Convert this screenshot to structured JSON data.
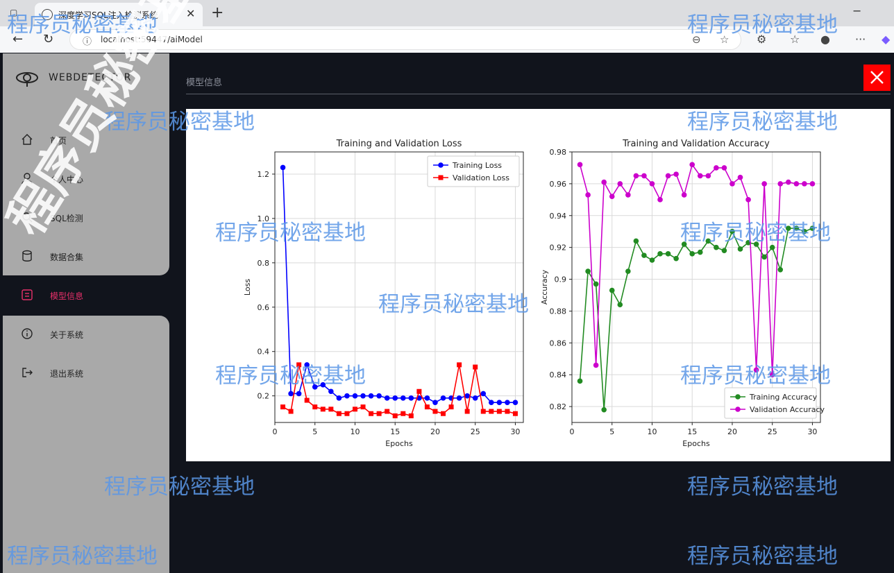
{
  "browser": {
    "tab_title": "深度学习SQL注入检测系统",
    "url": "localhost:59447/aiModel"
  },
  "sidebar": {
    "logo_text": "WEBDETECTOR",
    "items": [
      {
        "label": "首页",
        "icon": "home-icon"
      },
      {
        "label": "个人中心",
        "icon": "user-icon"
      },
      {
        "label": "SQL检测",
        "icon": "scan-icon"
      },
      {
        "label": "数据合集",
        "icon": "database-icon"
      },
      {
        "label": "模型信息",
        "icon": "model-icon"
      },
      {
        "label": "关于系统",
        "icon": "info-icon"
      },
      {
        "label": "退出系统",
        "icon": "logout-icon"
      }
    ],
    "active_index": 4
  },
  "main": {
    "title": "模型信息",
    "close_label": "✕"
  },
  "watermark": "程序员秘密基地",
  "colors": {
    "accent": "#e8306a",
    "close": "#ff0000",
    "training_loss": "#0000ff",
    "validation_loss": "#ff0000",
    "training_acc": "#228b22",
    "validation_acc": "#cc00cc"
  },
  "chart_data": [
    {
      "type": "line",
      "title": "Training and Validation Loss",
      "xlabel": "Epochs",
      "ylabel": "Loss",
      "xlim": [
        0,
        31
      ],
      "ylim": [
        0.08,
        1.3
      ],
      "xticks": [
        0,
        5,
        10,
        15,
        20,
        25,
        30
      ],
      "yticks": [
        0.2,
        0.4,
        0.6,
        0.8,
        1.0,
        1.2
      ],
      "grid": true,
      "legend": "top-right",
      "x": [
        1,
        2,
        3,
        4,
        5,
        6,
        7,
        8,
        9,
        10,
        11,
        12,
        13,
        14,
        15,
        16,
        17,
        18,
        19,
        20,
        21,
        22,
        23,
        24,
        25,
        26,
        27,
        28,
        29,
        30
      ],
      "series": [
        {
          "name": "Training Loss",
          "marker": "circle",
          "color": "#0000ff",
          "values": [
            1.23,
            0.21,
            0.21,
            0.34,
            0.24,
            0.25,
            0.22,
            0.19,
            0.2,
            0.2,
            0.2,
            0.2,
            0.2,
            0.19,
            0.19,
            0.19,
            0.19,
            0.19,
            0.19,
            0.17,
            0.19,
            0.19,
            0.19,
            0.2,
            0.19,
            0.21,
            0.17,
            0.17,
            0.17,
            0.17
          ]
        },
        {
          "name": "Validation Loss",
          "marker": "square",
          "color": "#ff0000",
          "values": [
            0.15,
            0.13,
            0.34,
            0.18,
            0.15,
            0.14,
            0.14,
            0.12,
            0.12,
            0.14,
            0.15,
            0.12,
            0.12,
            0.13,
            0.11,
            0.12,
            0.11,
            0.22,
            0.15,
            0.13,
            0.12,
            0.15,
            0.34,
            0.13,
            0.33,
            0.13,
            0.13,
            0.13,
            0.13,
            0.12
          ]
        }
      ]
    },
    {
      "type": "line",
      "title": "Training and Validation Accuracy",
      "xlabel": "Epochs",
      "ylabel": "Accuracy",
      "xlim": [
        0,
        31
      ],
      "ylim": [
        0.81,
        0.98
      ],
      "xticks": [
        0,
        5,
        10,
        15,
        20,
        25,
        30
      ],
      "yticks": [
        0.82,
        0.84,
        0.86,
        0.88,
        0.9,
        0.92,
        0.94,
        0.96,
        0.98
      ],
      "grid": true,
      "legend": "bottom-right",
      "x": [
        1,
        2,
        3,
        4,
        5,
        6,
        7,
        8,
        9,
        10,
        11,
        12,
        13,
        14,
        15,
        16,
        17,
        18,
        19,
        20,
        21,
        22,
        23,
        24,
        25,
        26,
        27,
        28,
        29,
        30
      ],
      "series": [
        {
          "name": "Training Accuracy",
          "marker": "circle",
          "color": "#228b22",
          "values": [
            0.836,
            0.905,
            0.897,
            0.818,
            0.893,
            0.884,
            0.905,
            0.924,
            0.915,
            0.912,
            0.916,
            0.916,
            0.913,
            0.922,
            0.916,
            0.917,
            0.924,
            0.92,
            0.918,
            0.93,
            0.919,
            0.923,
            0.922,
            0.914,
            0.92,
            0.906,
            0.932,
            0.932,
            0.93,
            0.932
          ]
        },
        {
          "name": "Validation Accuracy",
          "marker": "circle",
          "color": "#cc00cc",
          "values": [
            0.972,
            0.953,
            0.846,
            0.961,
            0.952,
            0.96,
            0.953,
            0.965,
            0.965,
            0.96,
            0.95,
            0.965,
            0.966,
            0.953,
            0.972,
            0.965,
            0.965,
            0.97,
            0.97,
            0.96,
            0.964,
            0.95,
            0.843,
            0.96,
            0.84,
            0.96,
            0.961,
            0.96,
            0.96,
            0.96
          ]
        }
      ]
    }
  ]
}
